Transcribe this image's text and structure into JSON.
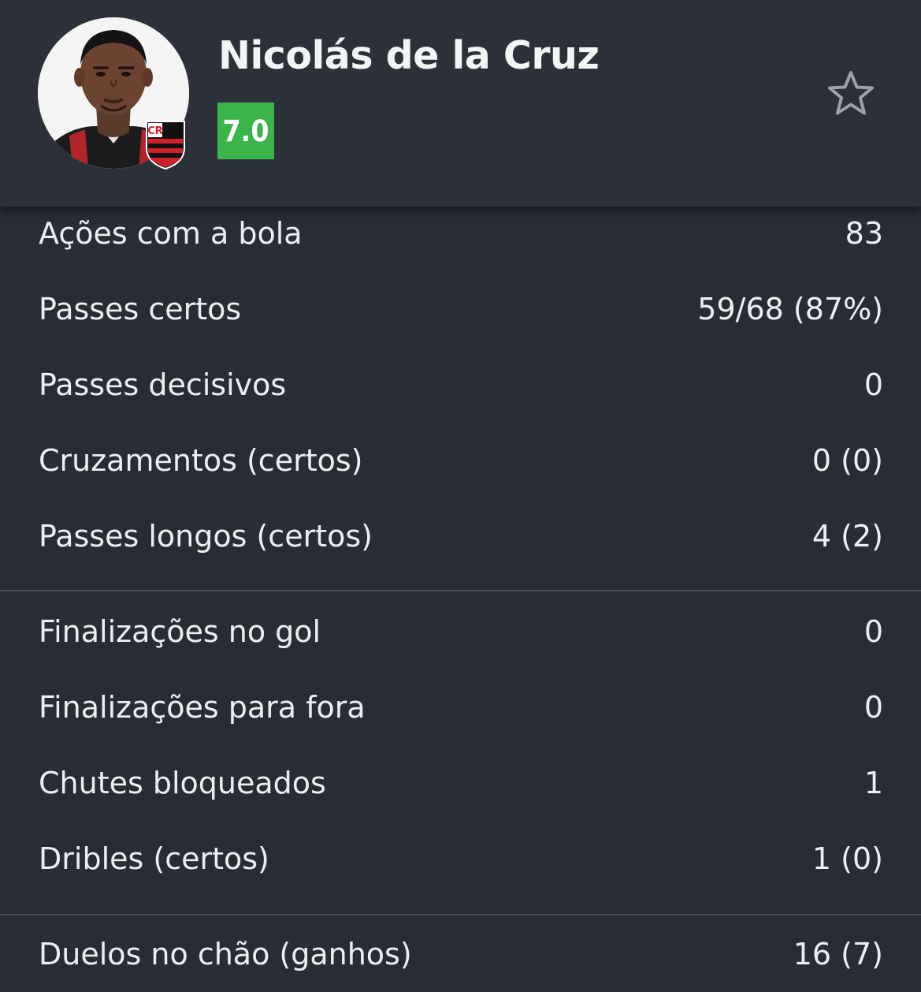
{
  "player": {
    "name": "Nicolás de la Cruz",
    "rating": "7.0",
    "rating_color": "#3bb54a",
    "avatar_icon": "player-photo",
    "club_icon": "flamengo-crest",
    "favorite_icon": "star-outline-icon"
  },
  "stats_group1": [
    {
      "label": "Ações com a bola",
      "value": "83"
    },
    {
      "label": "Passes certos",
      "value": "59/68 (87%)"
    },
    {
      "label": "Passes decisivos",
      "value": "0"
    },
    {
      "label": "Cruzamentos (certos)",
      "value": "0 (0)"
    },
    {
      "label": "Passes longos (certos)",
      "value": "4 (2)"
    }
  ],
  "stats_group2": [
    {
      "label": "Finalizações no gol",
      "value": "0"
    },
    {
      "label": "Finalizações para fora",
      "value": "0"
    },
    {
      "label": "Chutes bloqueados",
      "value": "1"
    },
    {
      "label": "Dribles (certos)",
      "value": "1 (0)"
    }
  ],
  "stats_group3": [
    {
      "label": "Duelos no chão (ganhos)",
      "value": "16 (7)"
    }
  ],
  "colors": {
    "background": "#292c34",
    "header": "#2c3038",
    "divider": "#474b53",
    "text": "#eceef1"
  }
}
